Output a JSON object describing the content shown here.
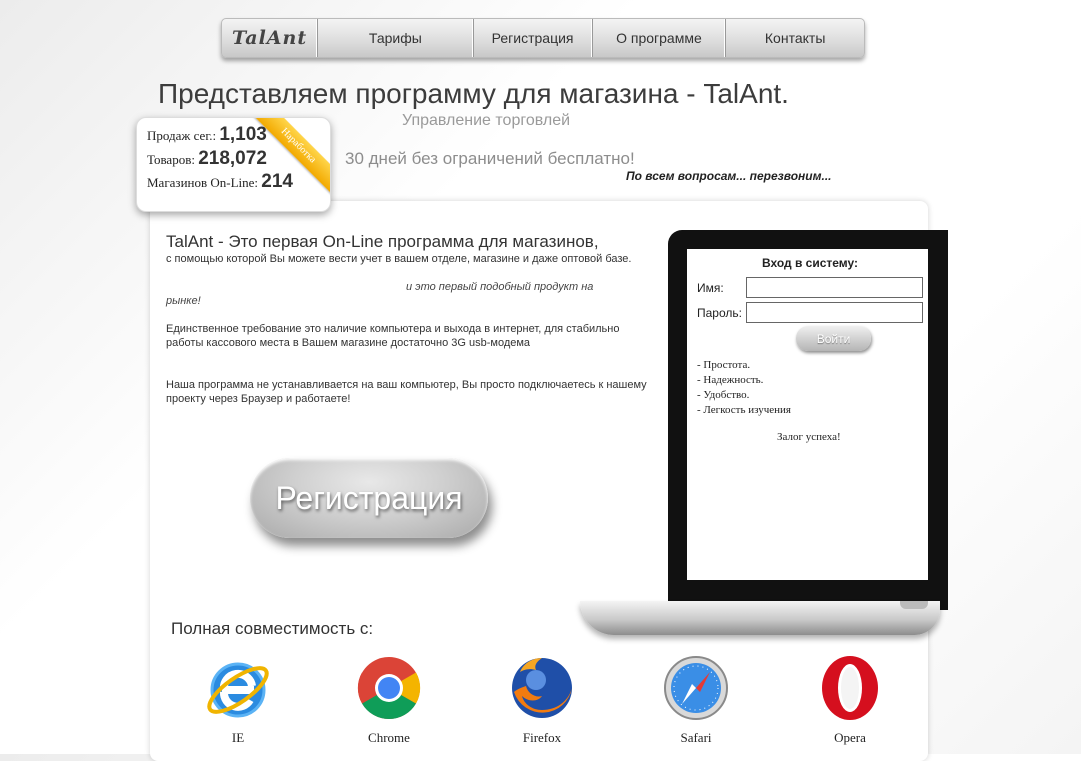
{
  "nav": {
    "logo": "TalAnt",
    "items": [
      "Тарифы",
      "Регистрация",
      "О программе",
      "Контакты"
    ]
  },
  "header": {
    "title": "Представляем программу для магазина - TalAnt.",
    "subtitle": "Управление торговлей",
    "trial": "30 дней без ограничений бесплатно!",
    "callback": "По всем вопросам... перезвоним..."
  },
  "stats": {
    "sales_label": "Продаж сег.:",
    "sales_value": "1,103",
    "goods_label": "Товаров:",
    "goods_value": "218,072",
    "shops_label": "Магазинов On-Line:",
    "shops_value": "214",
    "ribbon": "Наработка"
  },
  "intro": {
    "title": "TalAnt - Это первая On-Line программа для магазинов,",
    "text": "с помощью которой Вы можете вести учет в вашем отделе, магазине и даже оптовой базе.",
    "first_product": "и это первый подобный продукт на",
    "first_product_end": "рынке!",
    "requirement": "Единственное требование это наличие компьютера и выхода в интернет, для стабильно работы кассового места в Вашем магазине достаточно 3G usb-модема",
    "browser_note": "Наша программа не устанавливается на ваш компьютер, Вы просто подключаетесь к нашему проекту через Браузер и работаете!"
  },
  "register_button": "Регистрация",
  "login": {
    "title": "Вход в систему:",
    "name_label": "Имя:",
    "name_value": "",
    "password_label": "Пароль:",
    "password_value": "",
    "submit": "Войти",
    "features": [
      "- Простота.",
      "- Надежность.",
      "- Удобство.",
      "- Легкость изучения"
    ],
    "slogan": "Залог успеха!"
  },
  "compat": {
    "title": "Полная совместимость с:",
    "browsers": [
      "IE",
      "Chrome",
      "Firefox",
      "Safari",
      "Opera"
    ]
  },
  "colors": {
    "ribbon": "#f2a900",
    "laptop_bezel": "#111111"
  }
}
